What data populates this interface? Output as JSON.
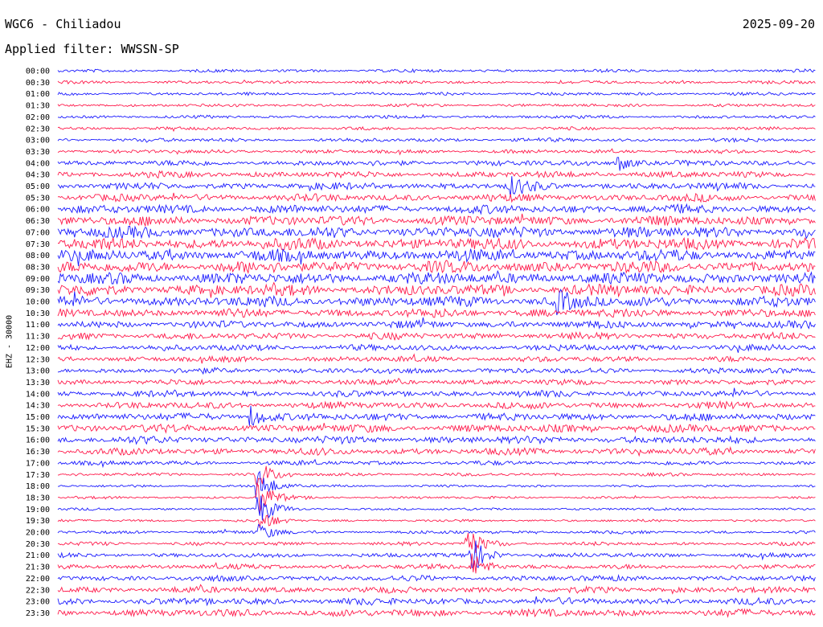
{
  "header": {
    "title": "WGC6 - Chiliadou",
    "date": "2025-09-20",
    "filter": "Applied filter: WWSSN-SP"
  },
  "colors": {
    "even_trace": "#1a1aff",
    "odd_trace": "#ff1a4b",
    "background": "#ffffff",
    "text": "#000000"
  },
  "chart_data": {
    "type": "line",
    "title": "WGC6 - Chiliadou",
    "ylabel": "EHZ - 30000",
    "xlabel": "",
    "ytick_labels": [
      "00:00",
      "00:30",
      "01:00",
      "01:30",
      "02:00",
      "02:30",
      "03:00",
      "03:30",
      "04:00",
      "04:30",
      "05:00",
      "05:30",
      "06:00",
      "06:30",
      "07:00",
      "07:30",
      "08:00",
      "08:30",
      "09:00",
      "09:30",
      "10:00",
      "10:30",
      "11:00",
      "11:30",
      "12:00",
      "12:30",
      "13:00",
      "13:30",
      "14:00",
      "14:30",
      "15:00",
      "15:30",
      "16:00",
      "16:30",
      "17:00",
      "17:30",
      "18:00",
      "18:30",
      "19:00",
      "19:30",
      "20:00",
      "20:30",
      "21:00",
      "21:30",
      "22:00",
      "22:30",
      "23:00",
      "23:30"
    ],
    "trace_amplitude": [
      0.25,
      0.25,
      0.25,
      0.25,
      0.25,
      0.25,
      0.3,
      0.3,
      0.45,
      0.5,
      0.55,
      0.6,
      0.7,
      0.8,
      0.9,
      0.95,
      0.95,
      0.95,
      0.95,
      0.9,
      0.85,
      0.7,
      0.6,
      0.55,
      0.5,
      0.45,
      0.45,
      0.45,
      0.5,
      0.55,
      0.6,
      0.65,
      0.6,
      0.55,
      0.35,
      0.25,
      0.2,
      0.2,
      0.2,
      0.2,
      0.25,
      0.3,
      0.35,
      0.4,
      0.45,
      0.5,
      0.55,
      0.6
    ],
    "events": [
      {
        "row": 35,
        "t": 0.265,
        "amp": 2.5
      },
      {
        "row": 36,
        "t": 0.265,
        "amp": 3.0
      },
      {
        "row": 37,
        "t": 0.266,
        "amp": 3.5
      },
      {
        "row": 38,
        "t": 0.266,
        "amp": 3.0
      },
      {
        "row": 39,
        "t": 0.267,
        "amp": 2.0
      },
      {
        "row": 40,
        "t": 0.268,
        "amp": 1.5
      },
      {
        "row": 41,
        "t": 0.54,
        "amp": 3.0
      },
      {
        "row": 42,
        "t": 0.545,
        "amp": 3.5
      },
      {
        "row": 43,
        "t": 0.548,
        "amp": 2.5
      },
      {
        "row": 30,
        "t": 0.255,
        "amp": 2.0
      },
      {
        "row": 20,
        "t": 0.66,
        "amp": 1.8
      },
      {
        "row": 8,
        "t": 0.74,
        "amp": 1.5
      },
      {
        "row": 10,
        "t": 0.6,
        "amp": 1.6
      }
    ]
  }
}
